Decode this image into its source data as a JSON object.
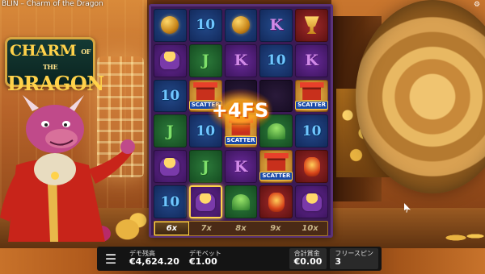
{
  "top_bar": {
    "text": "BLIN – Charm of the Dragon"
  },
  "logo": {
    "line1_a": "CHARM",
    "line1_b": "OF THE",
    "line2": "DRAGON"
  },
  "reels": {
    "rows": [
      [
        {
          "sym": "gem",
          "bg": "navy"
        },
        {
          "sym": "10",
          "bg": "navy"
        },
        {
          "sym": "gem",
          "bg": "navy"
        },
        {
          "sym": "K",
          "bg": "navy"
        },
        {
          "sym": "cup",
          "bg": "red"
        }
      ],
      [
        {
          "sym": "pot",
          "bg": "purple"
        },
        {
          "sym": "J",
          "bg": "green"
        },
        {
          "sym": "K",
          "bg": "purple"
        },
        {
          "sym": "10",
          "bg": "navy"
        },
        {
          "sym": "K",
          "bg": "purple"
        }
      ],
      [
        {
          "sym": "10",
          "bg": "navy"
        },
        {
          "sym": "scatter",
          "bg": "gold",
          "label": "SCATTER"
        },
        {
          "sym": "blank",
          "bg": "dark"
        },
        {
          "sym": "blank",
          "bg": "dark"
        },
        {
          "sym": "scatter",
          "bg": "gold",
          "label": "SCATTER"
        }
      ],
      [
        {
          "sym": "J",
          "bg": "green"
        },
        {
          "sym": "10",
          "bg": "navy"
        },
        {
          "sym": "scatter",
          "bg": "gold",
          "label": "SCATTER"
        },
        {
          "sym": "bell",
          "bg": "green"
        },
        {
          "sym": "10",
          "bg": "navy"
        }
      ],
      [
        {
          "sym": "pot",
          "bg": "purple"
        },
        {
          "sym": "J",
          "bg": "green"
        },
        {
          "sym": "K",
          "bg": "purple"
        },
        {
          "sym": "scatter",
          "bg": "gold",
          "label": "SCATTER"
        },
        {
          "sym": "lantern",
          "bg": "red"
        }
      ],
      [
        {
          "sym": "10",
          "bg": "navy"
        },
        {
          "sym": "pot",
          "bg": "purple",
          "highlight": true
        },
        {
          "sym": "bell",
          "bg": "green"
        },
        {
          "sym": "lantern",
          "bg": "red"
        },
        {
          "sym": "pot",
          "bg": "purple"
        }
      ]
    ],
    "feature_text": "+4FS",
    "multipliers": [
      {
        "label": "6x",
        "active": true
      },
      {
        "label": "7x",
        "active": false
      },
      {
        "label": "8x",
        "active": false
      },
      {
        "label": "9x",
        "active": false
      },
      {
        "label": "10x",
        "active": false
      }
    ]
  },
  "bottom_bar": {
    "menu_icon": "hamburger-icon",
    "balance_label": "デモ残高",
    "balance_value": "€4,624.20",
    "bet_label": "デモベット",
    "bet_value": "€1.00",
    "win_label": "合計賞金",
    "win_value": "€0.00",
    "freespins_label": "フリースピン",
    "freespins_value": "3"
  },
  "colors": {
    "reel_frame": "#3b1a55",
    "gold": "#ffd24a",
    "bottom_bar": "#141414"
  }
}
